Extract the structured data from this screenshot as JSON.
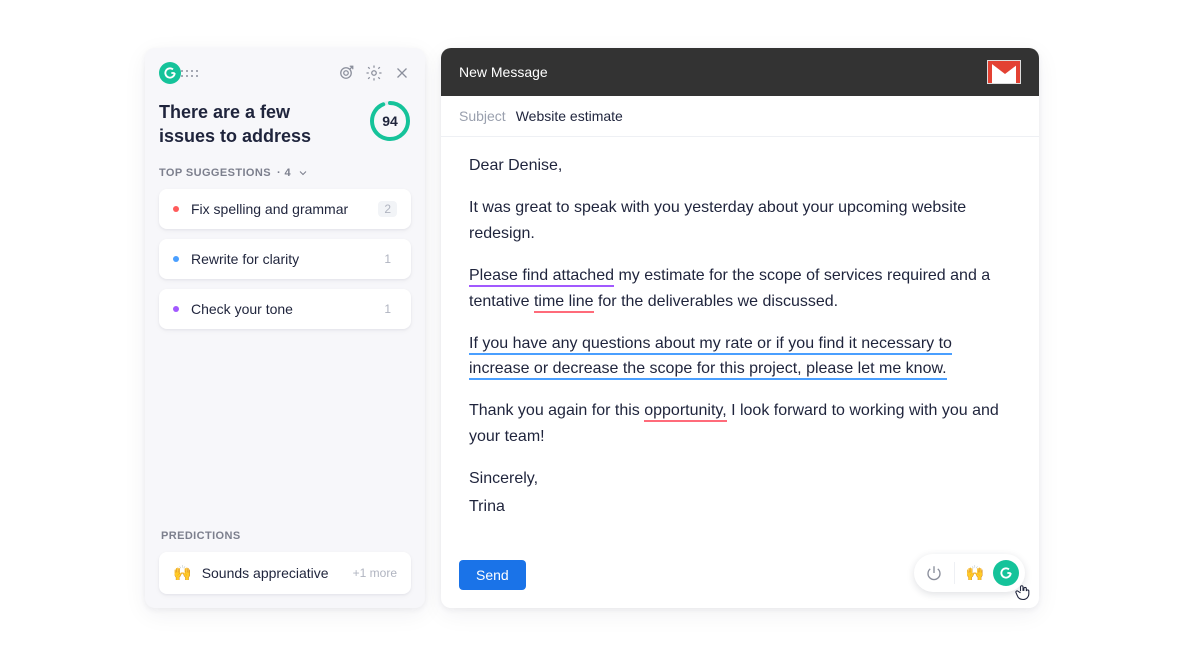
{
  "sidebar": {
    "title": "There are a few issues to address",
    "score": "94",
    "top_suggestions_label": "TOP SUGGESTIONS",
    "top_suggestions_count": "· 4",
    "suggestions": [
      {
        "label": "Fix spelling and grammar",
        "count": "2",
        "color": "#ff5b5b"
      },
      {
        "label": "Rewrite for clarity",
        "count": "1",
        "color": "#4a9fff"
      },
      {
        "label": "Check your tone",
        "count": "1",
        "color": "#a259ff"
      }
    ],
    "predictions_label": "PREDICTIONS",
    "prediction": {
      "emoji": "🙌",
      "text": "Sounds appreciative",
      "more": "+1 more"
    }
  },
  "compose": {
    "header": "New Message",
    "subject_label": "Subject",
    "subject_value": "Website estimate",
    "body": {
      "salutation": "Dear Denise,",
      "p1": "It was great to speak with you yesterday about your upcoming website redesign.",
      "p2_a": "Please find attached",
      "p2_b": " my estimate for the scope of services required and a tentative ",
      "p2_c": "time line",
      "p2_d": " for the deliverables we discussed.",
      "p3": "If you have any questions about my rate or if you find it necessary to increase or decrease the scope for this project, please let me know.",
      "p4_a": "Thank you again for this ",
      "p4_b": "opportunity,",
      "p4_c": " I look forward to working with you and your team!",
      "closing1": "Sincerely,",
      "closing2": "Trina"
    },
    "send_label": "Send"
  },
  "toolbar": {
    "emoji": "🙌"
  }
}
